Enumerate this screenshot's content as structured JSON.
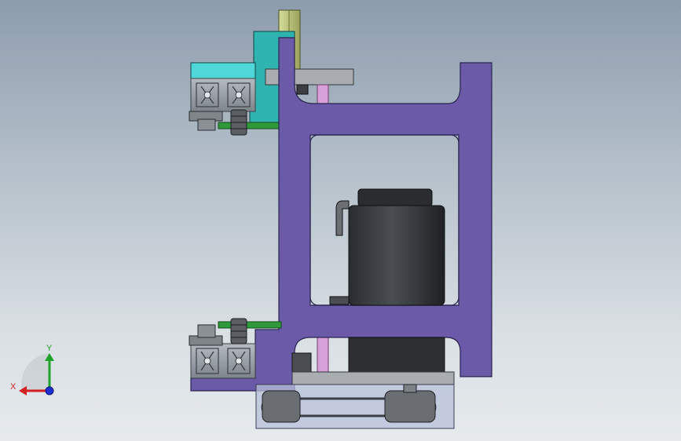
{
  "scene": {
    "colors": {
      "frame": "#6a5aa8",
      "frame_stroke": "#2a2450",
      "bracket": "#2fb3b0",
      "bracket_light": "#4fd6d8",
      "rail": "#b9c27a",
      "extrusion": "#8f969e",
      "extrusion_dark": "#3c4146",
      "motor_body": "#3a3d41",
      "motor_dark": "#222427",
      "rod": "#d7a0d8",
      "plate": "#a9adb2",
      "green_plate": "#2e9a3a",
      "belt_housing": "#b8c0d8",
      "pulley": "#5a5e63"
    }
  },
  "triad": {
    "x_label": "X",
    "y_label": "Y",
    "x_color": "#d42020",
    "y_color": "#1fa32b",
    "z_color": "#1f2fd4"
  }
}
